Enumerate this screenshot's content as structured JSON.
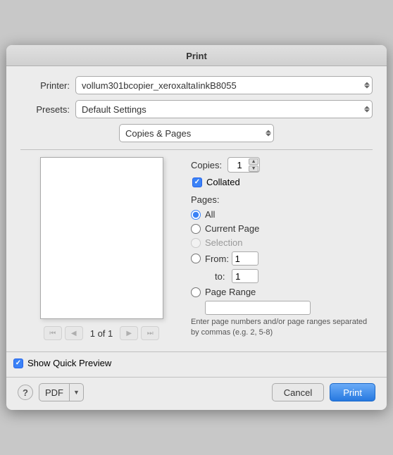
{
  "dialog": {
    "title": "Print",
    "printer_label": "Printer:",
    "printer_value": "vollum301bcopier_xeroxaltaIinkB8055",
    "presets_label": "Presets:",
    "presets_value": "Default Settings",
    "section_value": "Copies & Pages",
    "copies_label": "Copies:",
    "copies_value": "1",
    "collated_label": "Collated",
    "pages_label": "Pages:",
    "radio_all": "All",
    "radio_current": "Current Page",
    "radio_selection": "Selection",
    "radio_from": "From:",
    "from_value": "1",
    "to_label": "to:",
    "to_value": "1",
    "radio_page_range": "Page Range",
    "hint": "Enter page numbers and/or page ranges separated by commas (e.g. 2, 5-8)",
    "page_count": "1 of 1",
    "show_preview_label": "Show Quick Preview",
    "help_label": "?",
    "pdf_label": "PDF",
    "cancel_label": "Cancel",
    "print_label": "Print"
  }
}
